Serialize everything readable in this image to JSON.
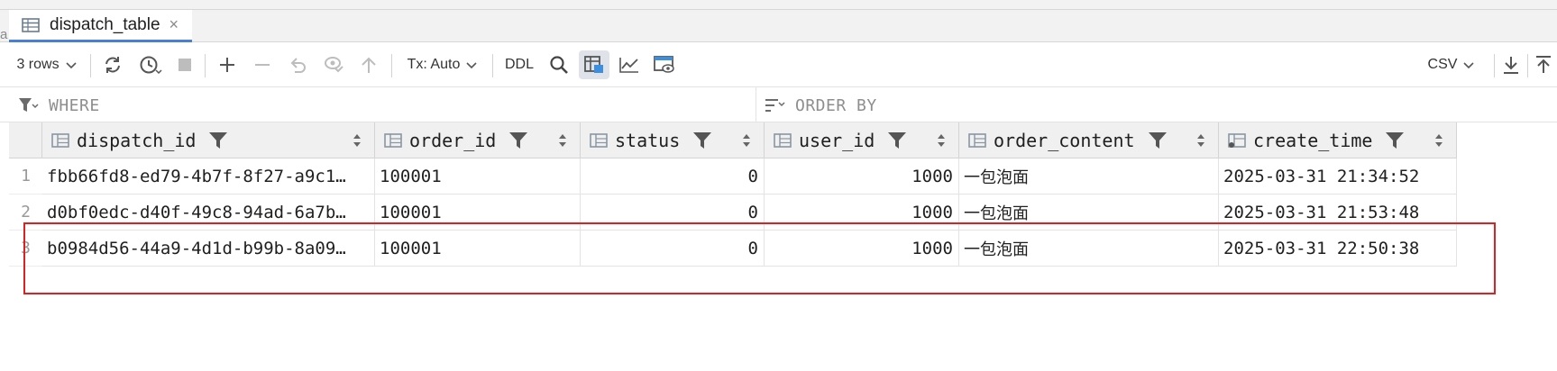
{
  "edge_char": "a",
  "tab": {
    "label": "dispatch_table",
    "close": "×"
  },
  "toolbar": {
    "rows_label": "3 rows",
    "tx_label": "Tx: Auto",
    "ddl_label": "DDL",
    "export_format": "CSV"
  },
  "filters": {
    "where": "WHERE",
    "order_by": "ORDER BY"
  },
  "columns": [
    {
      "name": "dispatch_id"
    },
    {
      "name": "order_id"
    },
    {
      "name": "status"
    },
    {
      "name": "user_id"
    },
    {
      "name": "order_content"
    },
    {
      "name": "create_time"
    }
  ],
  "rows": [
    {
      "num": "1",
      "dispatch_id": "fbb66fd8-ed79-4b7f-8f27-a9c1…",
      "order_id": "100001",
      "status": "0",
      "user_id": "1000",
      "order_content": "一包泡面",
      "create_time": "2025-03-31 21:34:52"
    },
    {
      "num": "2",
      "dispatch_id": "d0bf0edc-d40f-49c8-94ad-6a7b…",
      "order_id": "100001",
      "status": "0",
      "user_id": "1000",
      "order_content": "一包泡面",
      "create_time": "2025-03-31 21:53:48"
    },
    {
      "num": "3",
      "dispatch_id": "b0984d56-44a9-4d1d-b99b-8a09…",
      "order_id": "100001",
      "status": "0",
      "user_id": "1000",
      "order_content": "一包泡面",
      "create_time": "2025-03-31 22:50:38"
    }
  ],
  "colors": {
    "accent": "#4a7fd8",
    "highlight": "#e02020"
  }
}
